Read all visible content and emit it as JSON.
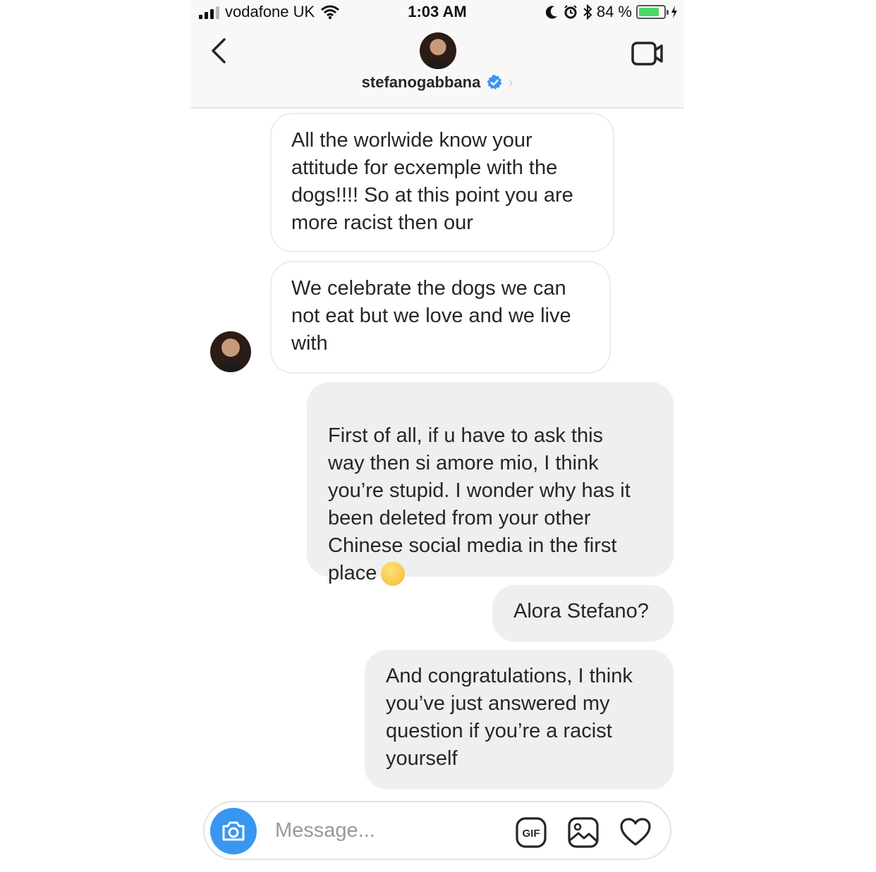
{
  "status_bar": {
    "carrier": "vodafone UK",
    "time": "1:03 AM",
    "battery_percent_label": "84 %",
    "battery_level": 0.84
  },
  "header": {
    "username": "stefanogabbana"
  },
  "messages": [
    {
      "from": "them",
      "text": "All the worlwide know your\nattitude for ecxemple with the\ndogs!!!! So at this point you are\nmore racist then our"
    },
    {
      "from": "them",
      "text": "We celebrate the dogs we can\nnot eat but we love and we live\nwith"
    },
    {
      "from": "me",
      "text": "First of all, if u have to ask this\nway then si amore mio, I think\nyou’re stupid. I wonder why has it\nbeen deleted from your other\nChinese social media in the first\nplace",
      "emoji": "thinking-face"
    },
    {
      "from": "me",
      "text": "Alora Stefano?"
    },
    {
      "from": "me",
      "text": "And congratulations, I think\nyou’ve just answered my\nquestion if you’re a racist\nyourself"
    }
  ],
  "composer": {
    "placeholder": "Message...",
    "gif_label": "GIF"
  },
  "icons": {
    "back": "chevron-left-icon",
    "video": "video-camera-icon",
    "verified": "verified-badge-icon",
    "camera": "camera-icon",
    "gif": "gif-icon",
    "gallery": "image-icon",
    "like": "heart-icon"
  },
  "colors": {
    "accent": "#3897f0",
    "outgoing_bubble": "#efefef",
    "battery": "#4cd964"
  }
}
